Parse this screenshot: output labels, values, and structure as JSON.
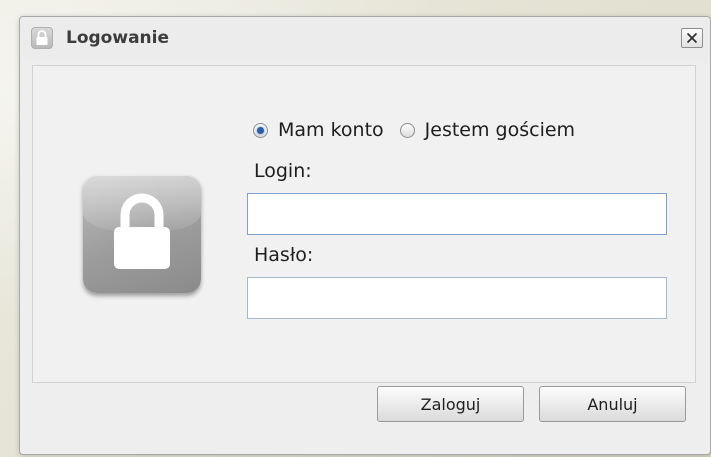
{
  "dialog": {
    "title": "Logowanie",
    "title_icon": "lock-icon",
    "close_icon": "close-icon"
  },
  "account_type": {
    "options": [
      {
        "label": "Mam konto",
        "selected": true
      },
      {
        "label": "Jestem gościem",
        "selected": false
      }
    ]
  },
  "form": {
    "login_label": "Login:",
    "login_value": "",
    "password_label": "Hasło:",
    "password_value": ""
  },
  "buttons": {
    "login_label": "Zaloguj",
    "cancel_label": "Anuluj"
  },
  "colors": {
    "radio_selected": "#2a5fa8",
    "input_border": "#a8b8cc",
    "badge_gray": "#9c9c9c"
  }
}
